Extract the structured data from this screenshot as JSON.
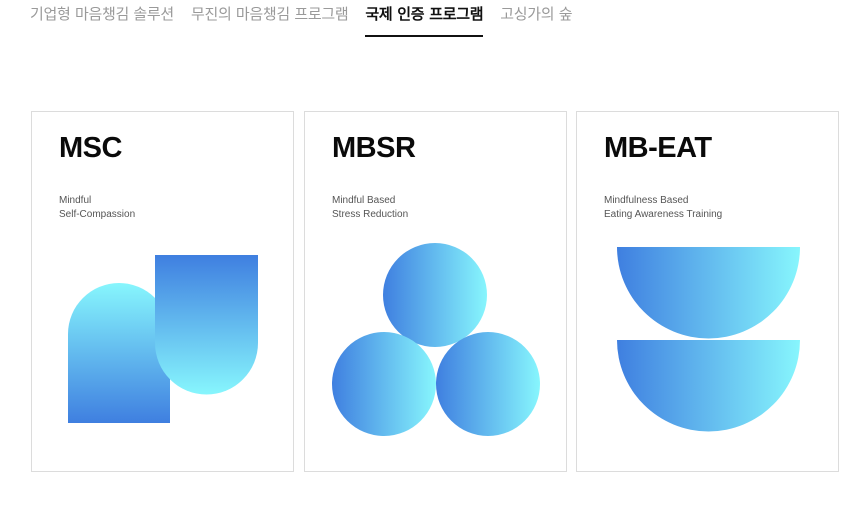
{
  "tabs": [
    {
      "label": "기업형 마음챙김 솔루션",
      "active": false
    },
    {
      "label": "무진의 마음챙김 프로그램",
      "active": false
    },
    {
      "label": "국제 인증 프로그램",
      "active": true
    },
    {
      "label": "고싱가의 숲",
      "active": false
    }
  ],
  "cards": [
    {
      "title": "MSC",
      "subtitle_line1": "Mindful",
      "subtitle_line2": "Self-Compassion"
    },
    {
      "title": "MBSR",
      "subtitle_line1": "Mindful Based",
      "subtitle_line2": "Stress Reduction"
    },
    {
      "title": "MB-EAT",
      "subtitle_line1": "Mindfulness Based",
      "subtitle_line2": "Eating Awareness Training"
    }
  ],
  "colors": {
    "gradient_blue": "#3f7fe0",
    "gradient_cyan": "#87f6fd",
    "active_tab": "#111111",
    "inactive_tab": "#9a9a9a",
    "card_border": "#dcdcdc"
  }
}
